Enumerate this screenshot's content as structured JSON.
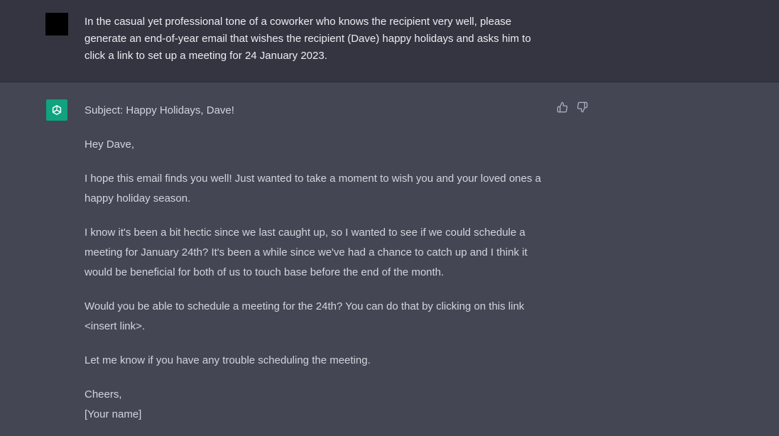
{
  "user_message": {
    "text": "In the casual yet professional tone of a coworker who knows the recipient very well, please generate an end-of-year email that wishes the recipient (Dave) happy holidays and asks him to click a link to set up a meeting for 24 January 2023."
  },
  "assistant_message": {
    "subject": "Subject: Happy Holidays, Dave!",
    "greeting": "Hey Dave,",
    "paragraph_1": "I hope this email finds you well! Just wanted to take a moment to wish you and your loved ones a happy holiday season.",
    "paragraph_2": "I know it's been a bit hectic since we last caught up, so I wanted to see if we could schedule a meeting for January 24th? It's been a while since we've had a chance to catch up and I think it would be beneficial for both of us to touch base before the end of the month.",
    "paragraph_3": "Would you be able to schedule a meeting for the 24th? You can do that by clicking on this link <insert link>.",
    "paragraph_4": "Let me know if you have any trouble scheduling the meeting.",
    "signoff": "Cheers,",
    "signature": "[Your name]"
  },
  "icons": {
    "assistant_avatar": "openai-logo-icon",
    "thumbs_up": "thumbs-up-icon",
    "thumbs_down": "thumbs-down-icon"
  },
  "colors": {
    "user_bg": "#343541",
    "assistant_bg": "#444654",
    "avatar_green": "#10a37f"
  }
}
